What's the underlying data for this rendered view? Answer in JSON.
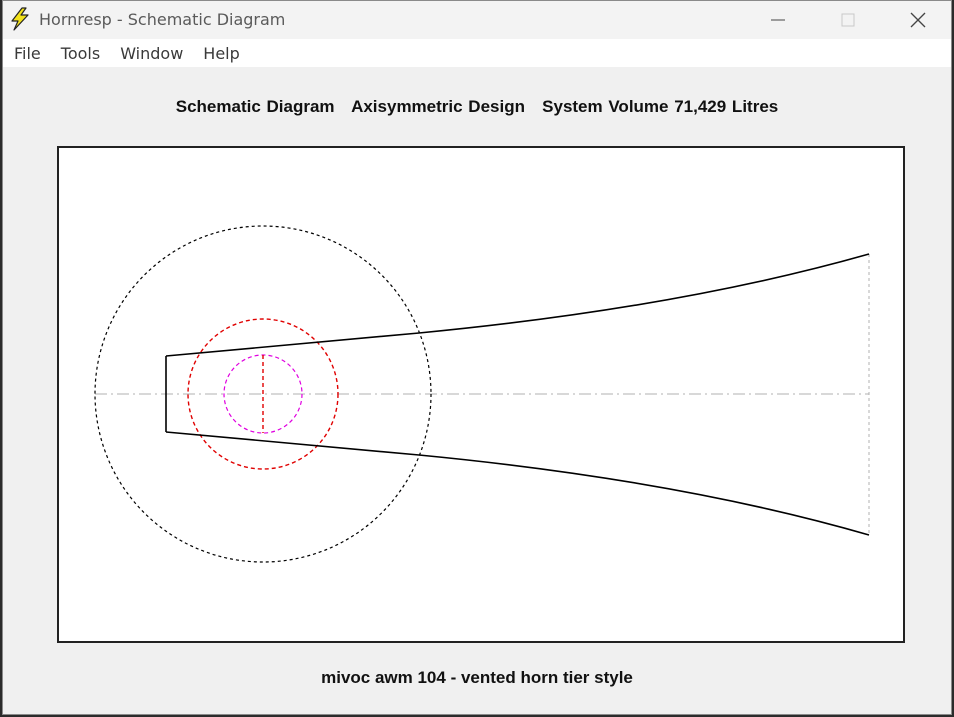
{
  "window": {
    "title": "Hornresp - Schematic Diagram",
    "icon": "lightning-bolt-icon",
    "controls": [
      "minimize-icon",
      "maximize-icon",
      "close-icon"
    ]
  },
  "menu": {
    "file": "File",
    "tools": "Tools",
    "window": "Window",
    "help": "Help"
  },
  "diagram": {
    "heading": "Schematic Diagram   Axisymmetric Design   System Volume 71,429 Litres",
    "caption": "mivoc awm 104 - vented horn tier style",
    "colors": {
      "horn": "#000000",
      "chamber": "#000000",
      "driver": "#e00000",
      "port": "#e000e0",
      "axis": "#b0b0b0"
    }
  }
}
